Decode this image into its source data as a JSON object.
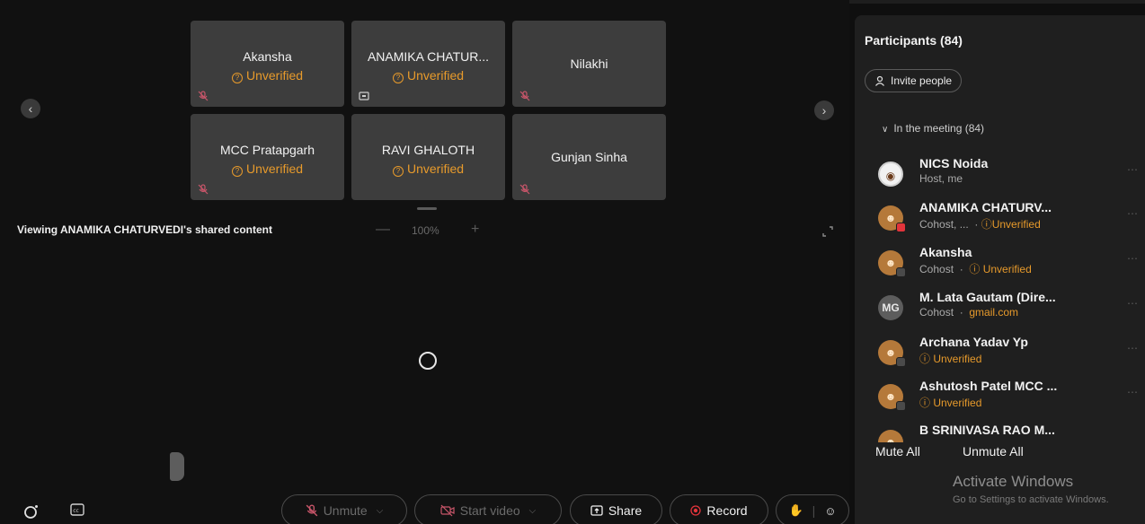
{
  "tiles": [
    {
      "name": "Akansha",
      "status": "Unverified",
      "icon": "mic-muted-icon"
    },
    {
      "name": "ANAMIKA CHATUR...",
      "status": "Unverified",
      "icon": "screen-share-icon"
    },
    {
      "name": "Nilakhi",
      "status": "",
      "icon": "mic-muted-icon"
    },
    {
      "name": "MCC Pratapgarh",
      "status": "Unverified",
      "icon": "mic-muted-icon"
    },
    {
      "name": "RAVI GHALOTH",
      "status": "Unverified",
      "icon": ""
    },
    {
      "name": "Gunjan Sinha",
      "status": "",
      "icon": "mic-muted-icon"
    }
  ],
  "stage": {
    "viewing": "Viewing ANAMIKA CHATURVEDI's shared content",
    "zoom": "100%",
    "zoom_minus": "—",
    "zoom_plus": "+"
  },
  "toolbar": {
    "unmute": "Unmute",
    "start_video": "Start video",
    "share": "Share",
    "record": "Record"
  },
  "panel": {
    "title": "Participants (84)",
    "invite": "Invite people",
    "section": "In the meeting (84)",
    "participants": [
      {
        "name": "NICS Noida",
        "role": "Host, me",
        "extra": "",
        "avatar": "logo",
        "badge": ""
      },
      {
        "name": "ANAMIKA CHATURV...",
        "role": "Cohost, ...",
        "extra": "Unverified",
        "avatar": "person",
        "badge": "red"
      },
      {
        "name": "Akansha",
        "role": "Cohost",
        "extra": "Unverified",
        "avatar": "person",
        "badge": "gray"
      },
      {
        "name": "M. Lata Gautam (Dire...",
        "role": "Cohost",
        "extra": "gmail.com",
        "avatar": "MG",
        "badge": "gray"
      },
      {
        "name": "Archana Yadav Yp",
        "role": "",
        "extra": "Unverified",
        "avatar": "person",
        "badge": "gray"
      },
      {
        "name": "Ashutosh Patel MCC ...",
        "role": "",
        "extra": "Unverified",
        "avatar": "person",
        "badge": "gray"
      },
      {
        "name": "B SRINIVASA RAO M...",
        "role": "",
        "extra": "",
        "avatar": "person",
        "badge": ""
      }
    ],
    "mute_all": "Mute All",
    "unmute_all": "Unmute All"
  },
  "watermark": {
    "title": "Activate Windows",
    "subtitle": "Go to Settings to activate Windows."
  },
  "colors": {
    "unverified": "#e79a2b",
    "end_call": "#e2343b",
    "tile": "#3d3d3d",
    "panel": "#1f1f1f"
  }
}
